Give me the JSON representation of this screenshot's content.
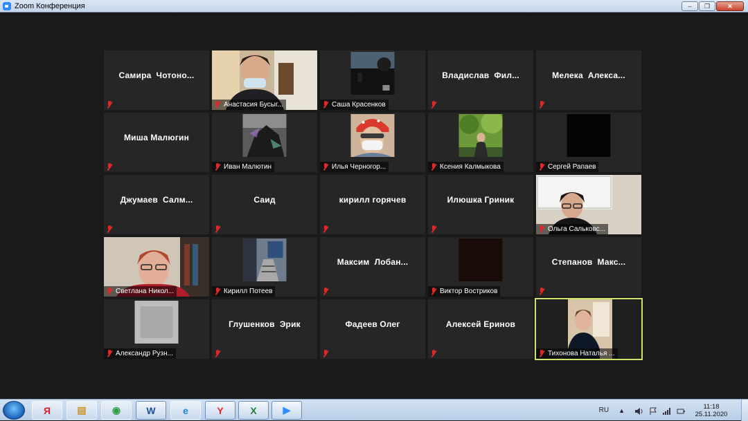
{
  "window": {
    "title": "Zoom Конференция",
    "minimize_glyph": "–",
    "maximize_glyph": "❐",
    "close_glyph": "✕"
  },
  "participants": [
    {
      "name": "Самира  Чотоно...",
      "footer": "",
      "video": null
    },
    {
      "name": "Анастасия Бусыг...",
      "footer": "Анастасия Бусыг...",
      "video": "full-girl"
    },
    {
      "name": "Саша Красенков",
      "footer": "Саша Красенков",
      "video": "dark-sky"
    },
    {
      "name": "Владислав  Фил...",
      "footer": "",
      "video": null
    },
    {
      "name": "Мелека  Алекса...",
      "footer": "",
      "video": null
    },
    {
      "name": "Миша Малюгин",
      "footer": "",
      "video": null
    },
    {
      "name": "Иван Малютин",
      "footer": "Иван Малютин",
      "video": "dark-glitch"
    },
    {
      "name": "Илья Черногор...",
      "footer": "Илья Черногор...",
      "video": "mask"
    },
    {
      "name": "Ксения Калмыкова",
      "footer": "Ксения Калмыкова",
      "video": "trees"
    },
    {
      "name": "Сергей Рапаев",
      "footer": "Сергей Рапаев",
      "video": "black"
    },
    {
      "name": "Джумаев  Салм...",
      "footer": "",
      "video": null
    },
    {
      "name": "Саид",
      "footer": "",
      "video": null
    },
    {
      "name": "кирилл горячев",
      "footer": "",
      "video": null
    },
    {
      "name": "Илюшка Гриник",
      "footer": "",
      "video": null
    },
    {
      "name": "Ольга Сальковс...",
      "footer": "Ольга Сальковс...",
      "video": "full-teacher"
    },
    {
      "name": "Светлана Никол...",
      "footer": "Светлана Никол...",
      "video": "full-woman"
    },
    {
      "name": "Кирилл Потеев",
      "footer": "Кирилл Потеев",
      "video": "room"
    },
    {
      "name": "Максим  Лобан...",
      "footer": "",
      "video": null
    },
    {
      "name": "Виктор Востриков",
      "footer": "Виктор Востриков",
      "video": "dark-brown"
    },
    {
      "name": "Степанов  Макс...",
      "footer": "",
      "video": null
    },
    {
      "name": "Александр Рузн...",
      "footer": "Александр Рузн...",
      "video": "blur"
    },
    {
      "name": "Глушенков  Эрик",
      "footer": "",
      "video": null
    },
    {
      "name": "Фадеев Олег",
      "footer": "",
      "video": null
    },
    {
      "name": "Алексей Еринов",
      "footer": "",
      "video": null
    },
    {
      "name": "Тихонова Наталья ...",
      "footer": "Тихонова Наталья ...",
      "video": "full-host",
      "active": true
    }
  ],
  "taskbar": {
    "items": [
      {
        "name": "yandex-browser-taskbar-button",
        "glyph": "Я",
        "color": "#d61f26",
        "state": "pinned"
      },
      {
        "name": "explorer-taskbar-button",
        "glyph": "▤",
        "color": "#c9962a",
        "state": "pinned"
      },
      {
        "name": "chrome-taskbar-button",
        "glyph": "◉",
        "color": "#2f9e44",
        "state": "pinned"
      },
      {
        "name": "word-taskbar-button",
        "glyph": "W",
        "color": "#1f4fa0",
        "state": "running"
      },
      {
        "name": "internet-explorer-taskbar-button",
        "glyph": "e",
        "color": "#1c86d6",
        "state": "pinned"
      },
      {
        "name": "yandex-taskbar-button",
        "glyph": "Y",
        "color": "#e3262f",
        "state": "running"
      },
      {
        "name": "excel-taskbar-button",
        "glyph": "X",
        "color": "#1e7b3a",
        "state": "running"
      },
      {
        "name": "zoom-taskbar-button",
        "glyph": "▶",
        "color": "#2d8cff",
        "state": "running"
      }
    ],
    "language": "RU",
    "tray_arrow": "▲",
    "time": "11:18",
    "date": "25.11.2020"
  }
}
